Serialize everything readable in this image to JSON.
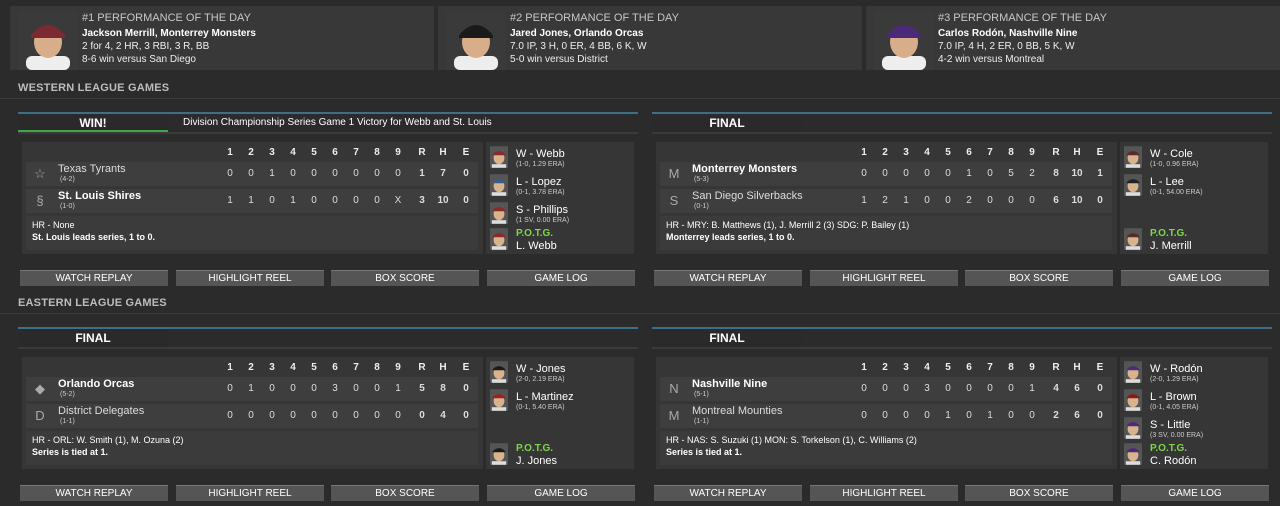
{
  "potd": [
    {
      "rank": "#1 PERFORMANCE OF THE DAY",
      "line1": "Jackson Merrill, Monterrey Monsters",
      "line2": "2 for 4, 2 HR, 3 RBI, 3 R, BB",
      "line3": "8-6 win versus San Diego",
      "cap": "#7a2a30"
    },
    {
      "rank": "#2 PERFORMANCE OF THE DAY",
      "line1": "Jared Jones, Orlando Orcas",
      "line2": "7.0 IP, 3 H, 0 ER, 4 BB, 6 K, W",
      "line3": "5-0 win versus District",
      "cap": "#1a1a1a"
    },
    {
      "rank": "#3 PERFORMANCE OF THE DAY",
      "line1": "Carlos Rodón, Nashville Nine",
      "line2": "7.0 IP, 4 H, 2 ER, 0 BB, 5 K, W",
      "line3": "4-2 win versus Montreal",
      "cap": "#4b2a7a"
    }
  ],
  "sections": {
    "western": "WESTERN LEAGUE GAMES",
    "eastern": "EASTERN LEAGUE GAMES"
  },
  "innings": [
    "1",
    "2",
    "3",
    "4",
    "5",
    "6",
    "7",
    "8",
    "9",
    "R",
    "H",
    "E"
  ],
  "buttons": {
    "replay": "WATCH REPLAY",
    "reel": "HIGHLIGHT REEL",
    "box": "BOX SCORE",
    "log": "GAME LOG"
  },
  "games": [
    {
      "status": "WIN!",
      "desc": "Division Championship Series Game 1 Victory for Webb and St. Louis",
      "teams": [
        {
          "name": "Texas Tyrants",
          "rec": "(4-2)",
          "bold": false,
          "logo": "☆",
          "line": [
            "0",
            "0",
            "1",
            "0",
            "0",
            "0",
            "0",
            "0",
            "0",
            "1",
            "7",
            "0"
          ]
        },
        {
          "name": "St. Louis Shires",
          "rec": "(1-0)",
          "bold": true,
          "logo": "§",
          "line": [
            "1",
            "1",
            "0",
            "1",
            "0",
            "0",
            "0",
            "0",
            "X",
            "3",
            "10",
            "0"
          ]
        }
      ],
      "notes": [
        "HR - None",
        "St. Louis leads series, 1 to 0."
      ],
      "pitchers": [
        {
          "name": "W - Webb",
          "stat": "(1-0, 1.29 ERA)",
          "cap": "#8a2a2a"
        },
        {
          "name": "L - Lopez",
          "stat": "(0-1, 3.78 ERA)",
          "cap": "#3a5a8a"
        },
        {
          "name": "S - Phillips",
          "stat": "(1 SV, 0.00 ERA)",
          "cap": "#8a2a2a"
        }
      ],
      "potg": {
        "label": "P.O.T.G.",
        "name": "L. Webb",
        "cap": "#8a2a2a"
      }
    },
    {
      "status": "FINAL",
      "desc": "",
      "teams": [
        {
          "name": "Monterrey Monsters",
          "rec": "(5-3)",
          "bold": true,
          "logo": "M",
          "line": [
            "0",
            "0",
            "0",
            "0",
            "0",
            "1",
            "0",
            "5",
            "2",
            "8",
            "10",
            "1"
          ]
        },
        {
          "name": "San Diego Silverbacks",
          "rec": "(0-1)",
          "bold": false,
          "logo": "S",
          "line": [
            "1",
            "2",
            "1",
            "0",
            "0",
            "2",
            "0",
            "0",
            "0",
            "6",
            "10",
            "0"
          ]
        }
      ],
      "notes": [
        "HR - MRY: B. Matthews (1), J. Merrill 2 (3)  SDG: P. Bailey (1)",
        "Monterrey leads series, 1 to 0."
      ],
      "pitchers": [
        {
          "name": "W - Cole",
          "stat": "(1-0, 0.96 ERA)",
          "cap": "#5a2a2a"
        },
        {
          "name": "L - Lee",
          "stat": "(0-1, 54.00 ERA)",
          "cap": "#222"
        }
      ],
      "potg": {
        "label": "P.O.T.G.",
        "name": "J. Merrill",
        "cap": "#5a2a2a"
      }
    },
    {
      "status": "FINAL",
      "desc": "",
      "teams": [
        {
          "name": "Orlando Orcas",
          "rec": "(5-2)",
          "bold": true,
          "logo": "◆",
          "line": [
            "0",
            "1",
            "0",
            "0",
            "0",
            "3",
            "0",
            "0",
            "1",
            "5",
            "8",
            "0"
          ]
        },
        {
          "name": "District Delegates",
          "rec": "(1-1)",
          "bold": false,
          "logo": "D",
          "line": [
            "0",
            "0",
            "0",
            "0",
            "0",
            "0",
            "0",
            "0",
            "0",
            "0",
            "4",
            "0"
          ]
        }
      ],
      "notes": [
        "HR - ORL: W. Smith (1), M. Ozuna (2)",
        "Series is tied at 1."
      ],
      "pitchers": [
        {
          "name": "W - Jones",
          "stat": "(2-0, 2.19 ERA)",
          "cap": "#1a1a1a"
        },
        {
          "name": "L - Martinez",
          "stat": "(0-1, 5.40 ERA)",
          "cap": "#a02020"
        }
      ],
      "potg": {
        "label": "P.O.T.G.",
        "name": "J. Jones",
        "cap": "#1a1a1a"
      }
    },
    {
      "status": "FINAL",
      "desc": "",
      "teams": [
        {
          "name": "Nashville Nine",
          "rec": "(5-1)",
          "bold": true,
          "logo": "N",
          "line": [
            "0",
            "0",
            "0",
            "3",
            "0",
            "0",
            "0",
            "0",
            "1",
            "4",
            "6",
            "0"
          ]
        },
        {
          "name": "Montreal Mounties",
          "rec": "(1-1)",
          "bold": false,
          "logo": "M",
          "line": [
            "0",
            "0",
            "0",
            "0",
            "1",
            "0",
            "1",
            "0",
            "0",
            "2",
            "6",
            "0"
          ]
        }
      ],
      "notes": [
        "HR - NAS: S. Suzuki (1)  MON: S. Torkelson (1), C. Williams (2)",
        "Series is tied at 1."
      ],
      "pitchers": [
        {
          "name": "W - Rodón",
          "stat": "(2-0, 1.29 ERA)",
          "cap": "#4b2a7a"
        },
        {
          "name": "L - Brown",
          "stat": "(0-1, 4.05 ERA)",
          "cap": "#8a1a1a"
        },
        {
          "name": "S - Little",
          "stat": "(3 SV, 0.00 ERA)",
          "cap": "#4b2a7a"
        }
      ],
      "potg": {
        "label": "P.O.T.G.",
        "name": "C. Rodón",
        "cap": "#4b2a7a"
      }
    }
  ]
}
